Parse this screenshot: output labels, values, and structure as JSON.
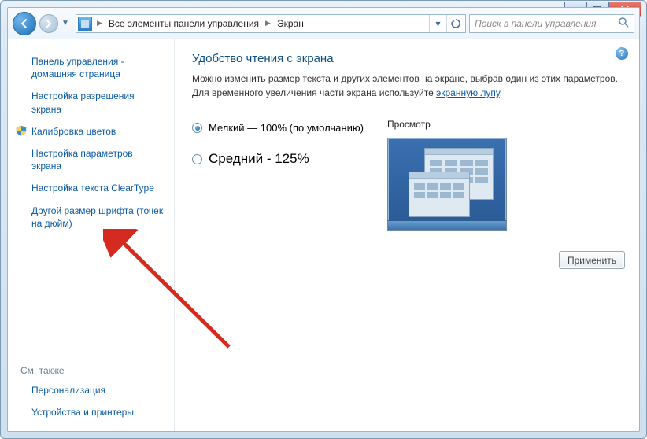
{
  "breadcrumb": {
    "item1": "Все элементы панели управления",
    "item2": "Экран"
  },
  "search": {
    "placeholder": "Поиск в панели управления"
  },
  "sidebar": {
    "home": "Панель управления - домашняя страница",
    "resolution": "Настройка разрешения экрана",
    "calibrate": "Калибровка цветов",
    "params": "Настройка параметров экрана",
    "cleartype": "Настройка текста ClearType",
    "dpi": "Другой размер шрифта (точек на дюйм)",
    "seealso_header": "См. также",
    "personalization": "Персонализация",
    "devices": "Устройства и принтеры"
  },
  "main": {
    "title": "Удобство чтения с экрана",
    "desc_before": "Можно изменить размер текста и других элементов на экране, выбрав один из этих параметров. Для временного увеличения части экрана используйте ",
    "desc_link": "экранную лупу",
    "desc_after": ".",
    "opt_small": "Мелкий — 100% (по умолчанию)",
    "opt_medium": "Средний - 125%",
    "preview_label": "Просмотр",
    "apply": "Применить"
  }
}
